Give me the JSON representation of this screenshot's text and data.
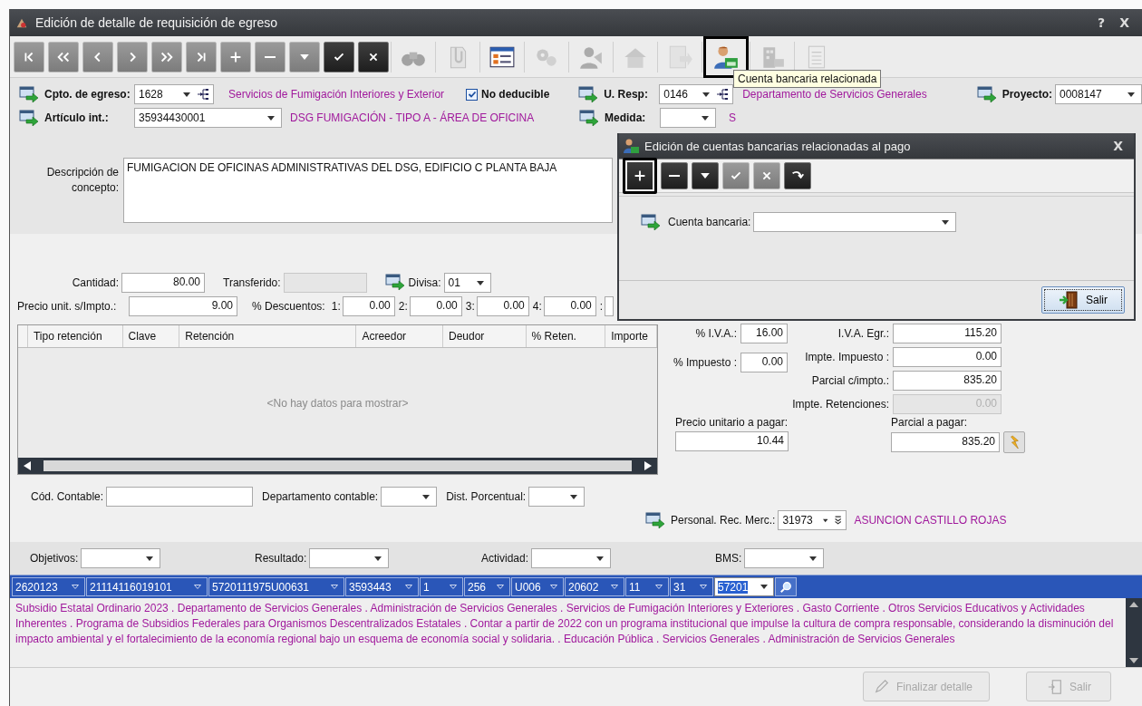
{
  "window": {
    "title": "Edición de detalle de requisición de egreso",
    "help": "?",
    "close": "X"
  },
  "toolbar": [
    {
      "kind": "first",
      "disabled": true,
      "highlighted": false
    },
    {
      "kind": "prevpage",
      "disabled": true,
      "highlighted": false
    },
    {
      "kind": "prev",
      "disabled": true,
      "highlighted": false
    },
    {
      "kind": "next",
      "disabled": true,
      "highlighted": false
    },
    {
      "kind": "nextpage",
      "disabled": true,
      "highlighted": false
    },
    {
      "kind": "last",
      "disabled": true,
      "highlighted": false
    },
    {
      "kind": "add",
      "disabled": true,
      "highlighted": false
    },
    {
      "kind": "remove",
      "disabled": true,
      "highlighted": false
    },
    {
      "kind": "drop",
      "disabled": true,
      "highlighted": false
    },
    {
      "kind": "ok",
      "disabled": false,
      "highlighted": false
    },
    {
      "kind": "cancel",
      "disabled": false,
      "highlighted": false
    },
    {
      "kind": "binoculars",
      "disabled": true,
      "highlighted": false
    },
    {
      "kind": "clip",
      "disabled": true,
      "highlighted": false
    },
    {
      "kind": "form",
      "disabled": false,
      "highlighted": false
    },
    {
      "kind": "gears",
      "disabled": true,
      "highlighted": false
    },
    {
      "kind": "person",
      "disabled": true,
      "highlighted": false
    },
    {
      "kind": "house",
      "disabled": true,
      "highlighted": false
    },
    {
      "kind": "docarrow",
      "disabled": true,
      "highlighted": false
    },
    {
      "kind": "personcard",
      "disabled": false,
      "highlighted": true
    },
    {
      "kind": "building",
      "disabled": true,
      "highlighted": false
    },
    {
      "kind": "doc",
      "disabled": true,
      "highlighted": false
    }
  ],
  "tooltip": {
    "text": "Cuenta bancaria relacionada"
  },
  "form": {
    "cpto": {
      "label": "Cpto. de egreso:",
      "value": "1628",
      "description": "Servicios de Fumigación Interiores y Exterior"
    },
    "no_deducible": {
      "label": "No deducible",
      "checked": true
    },
    "u_resp": {
      "label": "U. Resp:",
      "value": "0146",
      "description": "Departamento de Servicios Generales"
    },
    "proyecto": {
      "label": "Proyecto:",
      "value": "0008147"
    },
    "articulo": {
      "label": "Artículo int.:",
      "value": "35934430001",
      "description": "DSG FUMIGACIÓN - TIPO A - ÁREA DE OFICINA"
    },
    "medida": {
      "label": "Medida:",
      "description": "S"
    },
    "descripcion": {
      "label": "Descripción de concepto:",
      "value": "FUMIGACION DE OFICINAS ADMINISTRATIVAS DEL DSG, EDIFICIO C PLANTA BAJA"
    },
    "cantidad": {
      "label": "Cantidad:",
      "value": "80.00"
    },
    "transferido": {
      "label": "Transferido:",
      "disabled": true
    },
    "divisa": {
      "label": "Divisa:",
      "value": "01"
    },
    "precio": {
      "label": "Precio unit. s/Impto.:",
      "value": "9.00"
    },
    "descuentos": {
      "label": "% Descuentos:",
      "items": [
        {
          "label": "1:",
          "value": "0.00"
        },
        {
          "label": "2:",
          "value": "0.00"
        },
        {
          "label": "3:",
          "value": "0.00"
        },
        {
          "label": "4:",
          "value": "0.00"
        },
        {
          "label": ":"
        }
      ]
    }
  },
  "retenciones": {
    "columns": [
      "Tipo retención",
      "Clave",
      "Retención",
      "Acreedor",
      "Deudor",
      "% Reten.",
      "Importe"
    ],
    "empty_text": "<No hay datos para mostrar>"
  },
  "totales": {
    "iva_pct": {
      "label": "% I.V.A.:",
      "value": "16.00"
    },
    "impuesto_pct": {
      "label": "% Impuesto :",
      "value": "0.00"
    },
    "right": [
      {
        "label": "I.V.A. Egr.:",
        "value": "115.20",
        "disabled": false
      },
      {
        "label": "Impte. Impuesto :",
        "value": "0.00",
        "disabled": false
      },
      {
        "label": "Parcial c/impto.:",
        "value": "835.20",
        "disabled": false
      },
      {
        "label": "Impte. Retenciones:",
        "value": "0.00",
        "disabled": true
      }
    ],
    "precio_pagar": {
      "label": "Precio unitario a pagar:",
      "value": "10.44"
    },
    "parcial_pagar": {
      "label": "Parcial a pagar:",
      "value": "835.20"
    }
  },
  "contable": {
    "cod": {
      "label": "Cód. Contable:"
    },
    "departamento": {
      "label": "Departamento contable:"
    },
    "dist": {
      "label": "Dist. Porcentual:"
    }
  },
  "personal": {
    "label": "Personal. Rec. Merc.:",
    "value": "31973",
    "name": "ASUNCION CASTILLO ROJAS"
  },
  "objetivos": [
    {
      "label": "Objetivos:"
    },
    {
      "label": "Resultado:"
    },
    {
      "label": "Actividad:"
    },
    {
      "label": "BMS:"
    }
  ],
  "segments": [
    {
      "value": "2620123",
      "selected": false
    },
    {
      "value": "21114116019101",
      "selected": false
    },
    {
      "value": "5720111975U00631",
      "selected": false
    },
    {
      "value": "3593443",
      "selected": false
    },
    {
      "value": "1",
      "selected": false
    },
    {
      "value": "256",
      "selected": false
    },
    {
      "value": "U006",
      "selected": false
    },
    {
      "value": "20602",
      "selected": false
    },
    {
      "value": "11",
      "selected": false
    },
    {
      "value": "31",
      "selected": false
    },
    {
      "value": "57201",
      "selected": true
    }
  ],
  "summary": "Subsidio Estatal Ordinario 2023 . Departamento de Servicios Generales . Administración de Servicios Generales . Servicios de Fumigación Interiores y Exteriores . Gasto Corriente . Otros Servicios Educativos y Actividades Inherentes . Programa de Subsidios Federales para Organismos Descentralizados Estatales . Contar a partir de 2022 con un programa institucional que impulse la cultura de compra responsable, considerando la disminución del impacto ambiental y el fortalecimiento de la economía regional bajo un esquema de economía social y solidaria. . Educación Pública . Servicios Generales . Administración de Servicios Generales",
  "buttons": [
    {
      "label": "Finalizar detalle",
      "kind": "finish",
      "disabled": true
    },
    {
      "label": "Salir",
      "kind": "exit",
      "disabled": true
    }
  ],
  "dialog": {
    "title": "Edición de cuentas bancarias relacionadas al pago",
    "close": "X",
    "toolbar": [
      {
        "kind": "add",
        "disabled": false,
        "highlighted": true
      },
      {
        "kind": "remove",
        "disabled": false,
        "highlighted": false
      },
      {
        "kind": "drop",
        "disabled": false,
        "highlighted": false
      },
      {
        "kind": "ok",
        "disabled": true,
        "highlighted": false
      },
      {
        "kind": "cancel",
        "disabled": true,
        "highlighted": false
      },
      {
        "kind": "redo",
        "disabled": false,
        "highlighted": false
      }
    ],
    "field": {
      "label": "Cuenta bancaria:"
    },
    "button": {
      "label": "Salir"
    }
  }
}
